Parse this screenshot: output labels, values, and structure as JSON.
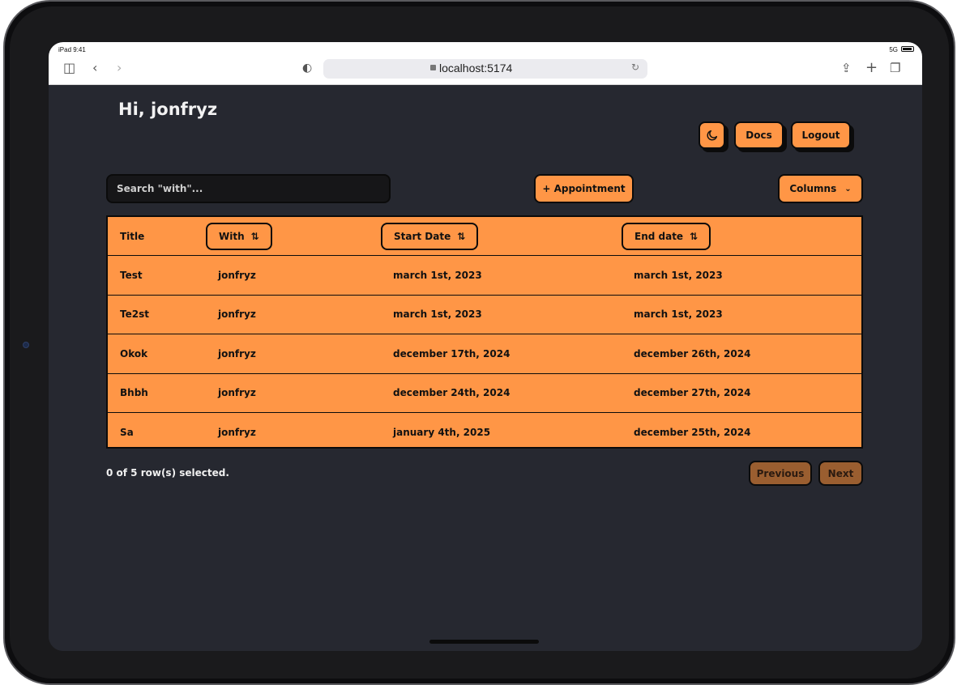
{
  "device": {
    "model": "iPad",
    "time": "9:41",
    "signal": "5G"
  },
  "browser": {
    "url": "localhost:5174"
  },
  "header": {
    "greeting": "Hi, jonfryz",
    "docs_label": "Docs",
    "logout_label": "Logout"
  },
  "toolbar": {
    "search_placeholder": "Search \"with\"...",
    "appointment_label": "+ Appointment",
    "columns_label": "Columns"
  },
  "table": {
    "headers": {
      "title": "Title",
      "with": "With",
      "start": "Start Date",
      "end": "End date"
    },
    "rows": [
      {
        "title": "Test",
        "with": "jonfryz",
        "start": "march 1st, 2023",
        "end": "march 1st, 2023"
      },
      {
        "title": "Te2st",
        "with": "jonfryz",
        "start": "march 1st, 2023",
        "end": "march 1st, 2023"
      },
      {
        "title": "Okok",
        "with": "jonfryz",
        "start": "december 17th, 2024",
        "end": "december 26th, 2024"
      },
      {
        "title": "Bhbh",
        "with": "jonfryz",
        "start": "december 24th, 2024",
        "end": "december 27th, 2024"
      },
      {
        "title": "Sa",
        "with": "jonfryz",
        "start": "january 4th, 2025",
        "end": "december 25th, 2024"
      }
    ]
  },
  "footer": {
    "selection_text": "0 of 5 row(s) selected.",
    "previous_label": "Previous",
    "next_label": "Next"
  },
  "colors": {
    "accent": "#ff9646",
    "background": "#262830",
    "border": "#0b0b0b",
    "disabled": "#9a5e30"
  }
}
